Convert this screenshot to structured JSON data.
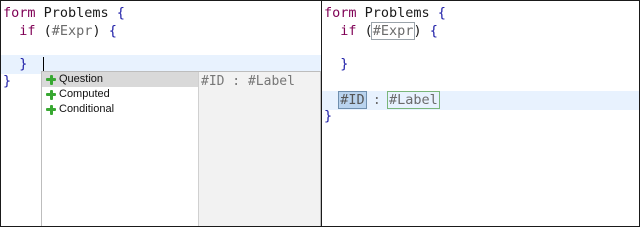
{
  "left_editor": {
    "line1": {
      "kw": "form",
      "name": " Problems ",
      "brace": "{"
    },
    "line2": {
      "indent": "  ",
      "kw": "if",
      "open": " (",
      "placeholder": "#Expr",
      "close": ")",
      "brace": " {"
    },
    "line4": {
      "indent": "  ",
      "brace": "}"
    },
    "line5": {
      "brace": "}"
    }
  },
  "assist": {
    "items": [
      "Question",
      "Computed",
      "Conditional"
    ],
    "selected_index": 0,
    "preview": "#ID : #Label"
  },
  "right_editor": {
    "line1": {
      "kw": "form",
      "name": " Problems ",
      "brace": "{"
    },
    "line2": {
      "indent": "  ",
      "kw": "if",
      "open": " (",
      "placeholder": "#Expr",
      "close": ")",
      "brace": " {"
    },
    "line4": {
      "indent": "  ",
      "brace": "}"
    },
    "line6": {
      "indent": "  ",
      "id_placeholder": "#ID",
      "sep": " : ",
      "label_placeholder": "#Label"
    },
    "line7": {
      "brace": "}"
    }
  },
  "colors": {
    "keyword": "#7f0055",
    "brace": "#1a1aa6",
    "current_line": "#e8f2fe",
    "add_icon": "#38a832"
  }
}
